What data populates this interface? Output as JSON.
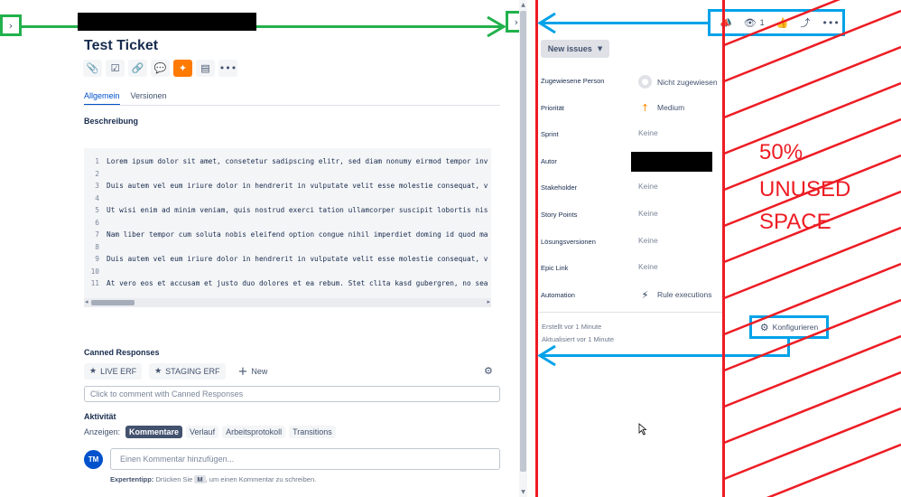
{
  "ticket": {
    "title": "Test Ticket",
    "toolbar": [
      {
        "name": "attach-icon",
        "glyph": "📎"
      },
      {
        "name": "checklist-icon",
        "glyph": "☑"
      },
      {
        "name": "link-icon",
        "glyph": "🔗"
      },
      {
        "name": "chat-icon",
        "glyph": "💬"
      },
      {
        "name": "app-icon",
        "glyph": "✦",
        "accent": "#ff7a00"
      },
      {
        "name": "document-icon",
        "glyph": "🗒"
      },
      {
        "name": "more-icon",
        "glyph": "•••"
      }
    ],
    "tabs": [
      {
        "label": "Allgemein",
        "active": true
      },
      {
        "label": "Versionen",
        "active": false
      }
    ],
    "description_label": "Beschreibung",
    "code_lines": [
      {
        "n": "1",
        "text": "Lorem ipsum dolor sit amet, consetetur sadipscing elitr, sed diam nonumy eirmod tempor inv"
      },
      {
        "n": "2",
        "text": ""
      },
      {
        "n": "3",
        "text": "Duis autem vel eum iriure dolor in hendrerit in vulputate velit esse molestie consequat, v"
      },
      {
        "n": "4",
        "text": ""
      },
      {
        "n": "5",
        "text": "Ut wisi enim ad minim veniam, quis nostrud exerci tation ullamcorper suscipit lobortis nis"
      },
      {
        "n": "6",
        "text": ""
      },
      {
        "n": "7",
        "text": "Nam liber tempor cum soluta nobis eleifend option congue nihil imperdiet doming id quod ma"
      },
      {
        "n": "8",
        "text": ""
      },
      {
        "n": "9",
        "text": "Duis autem vel eum iriure dolor in hendrerit in vulputate velit esse molestie consequat, v"
      },
      {
        "n": "10",
        "text": ""
      },
      {
        "n": "11",
        "text": "At vero eos et accusam et justo duo dolores et ea rebum. Stet clita kasd gubergren, no sea"
      }
    ]
  },
  "canned": {
    "label": "Canned Responses",
    "chips": [
      "LIVE ERF",
      "STAGING ERF"
    ],
    "new_label": "New",
    "placeholder": "Click to comment with Canned Responses"
  },
  "activity": {
    "label": "Aktivität",
    "show_label": "Anzeigen:",
    "filters": [
      {
        "label": "Kommentare",
        "active": true
      },
      {
        "label": "Verlauf",
        "active": false
      },
      {
        "label": "Arbeitsprotokoll",
        "active": false
      },
      {
        "label": "Transitions",
        "active": false
      }
    ],
    "avatar_initials": "TM",
    "comment_placeholder": "Einen Kommentar hinzufügen...",
    "tip_bold": "Expertentipp:",
    "tip_before": "Drücken Sie",
    "tip_key": "M",
    "tip_after": ", um einen Kommentar zu schreiben."
  },
  "right": {
    "watch_count": "1",
    "status": "New issues",
    "fields": [
      {
        "label": "Zugewiesene Person",
        "value": "Nicht zugewiesen",
        "icon": "avatar"
      },
      {
        "label": "Priorität",
        "value": "Medium",
        "icon": "priority"
      },
      {
        "label": "Sprint",
        "value": "Keine",
        "icon": ""
      },
      {
        "label": "Autor",
        "value": "",
        "icon": "redacted"
      },
      {
        "label": "Stakeholder",
        "value": "Keine",
        "icon": ""
      },
      {
        "label": "Story Points",
        "value": "Keine",
        "icon": ""
      },
      {
        "label": "Lösungsversionen",
        "value": "Keine",
        "icon": ""
      },
      {
        "label": "Epic Link",
        "value": "Keine",
        "icon": ""
      },
      {
        "label": "Automation",
        "value": "Rule executions",
        "icon": "bolt"
      }
    ],
    "created": "Erstellt vor 1 Minute",
    "updated": "Aktualisiert vor 1 Minute",
    "configure": "Konfigurieren"
  },
  "annotation": {
    "lines": [
      "50%",
      "UNUSED",
      "SPACE"
    ],
    "red": "#ed1c24",
    "green": "#22b14c",
    "blue": "#00a2e8"
  }
}
